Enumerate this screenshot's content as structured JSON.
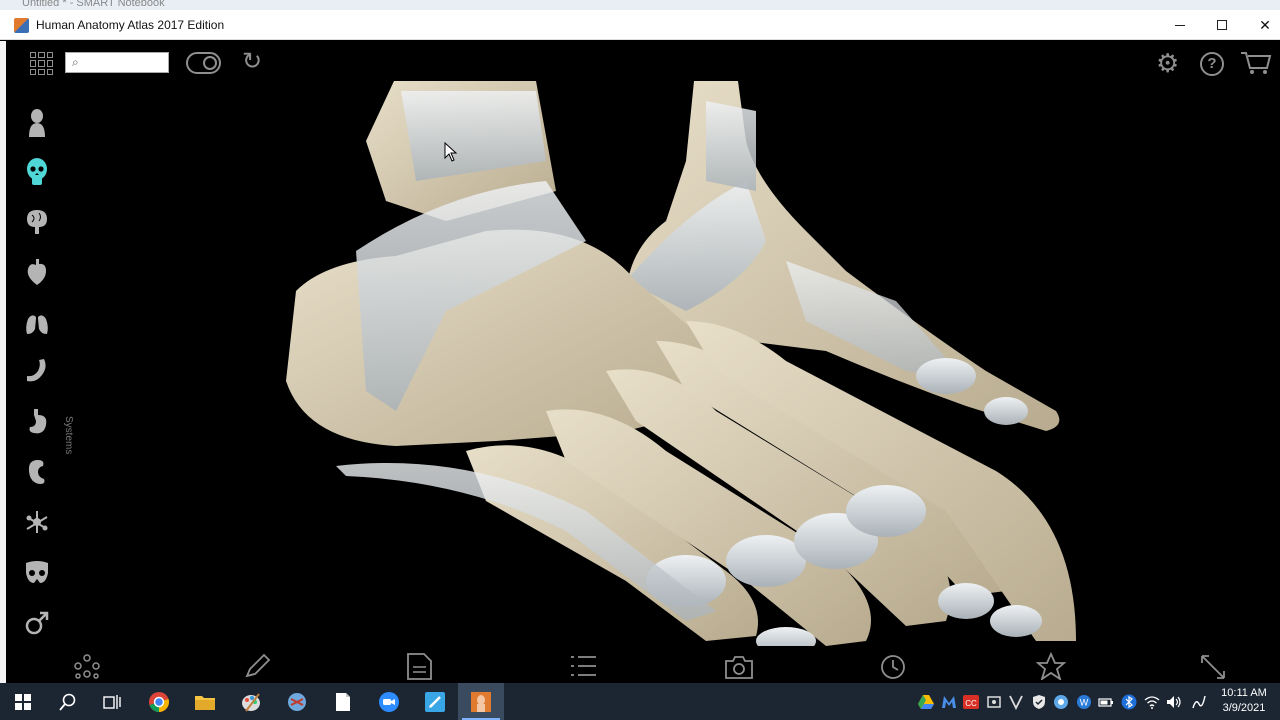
{
  "behind_window": {
    "title": "Untitled * - SMART Notebook"
  },
  "titlebar": {
    "title": "Human Anatomy Atlas 2017 Edition"
  },
  "toolbar": {
    "search_placeholder": "",
    "icons": [
      "grid-icon",
      "search-icon",
      "gender-toggle-icon",
      "reset-icon",
      "settings-icon",
      "help-icon",
      "cart-icon"
    ]
  },
  "sidebar": {
    "label": "Systems",
    "items": [
      {
        "name": "skin",
        "icon": "body-icon"
      },
      {
        "name": "skeleton",
        "icon": "skull-icon",
        "active": true,
        "color": "#4fd6d6"
      },
      {
        "name": "nervous",
        "icon": "brain-icon"
      },
      {
        "name": "cardiovascular",
        "icon": "heart-icon"
      },
      {
        "name": "respiratory",
        "icon": "lungs-icon"
      },
      {
        "name": "muscular",
        "icon": "arm-icon"
      },
      {
        "name": "digestive",
        "icon": "stomach-icon"
      },
      {
        "name": "urinary",
        "icon": "kidney-icon"
      },
      {
        "name": "lymphatic",
        "icon": "nodes-icon"
      },
      {
        "name": "reproductive-female",
        "icon": "pelvis-icon"
      },
      {
        "name": "reproductive-male",
        "icon": "male-symbol-icon"
      }
    ]
  },
  "bottombar": {
    "icons": [
      "molecule-icon",
      "pencil-icon",
      "notes-icon",
      "list-icon",
      "camera-icon",
      "history-icon",
      "star-icon",
      "fullscreen-icon"
    ]
  },
  "taskbar": {
    "apps": [
      "windows-start-icon",
      "search-icon",
      "task-view-icon",
      "chrome-icon",
      "file-explorer-icon",
      "paint-icon",
      "snipping-icon",
      "document-icon",
      "zoom-icon",
      "smart-notebook-icon",
      "anatomy-atlas-icon"
    ],
    "time": "10:11 AM",
    "date": "3/9/2021"
  },
  "colors": {
    "bone": "#d9cfb8",
    "ligament": "#dfe3e6",
    "accent_active": "#4fd6d6",
    "icon_gray": "#8f8f8f",
    "taskbar": "#1c2633"
  }
}
